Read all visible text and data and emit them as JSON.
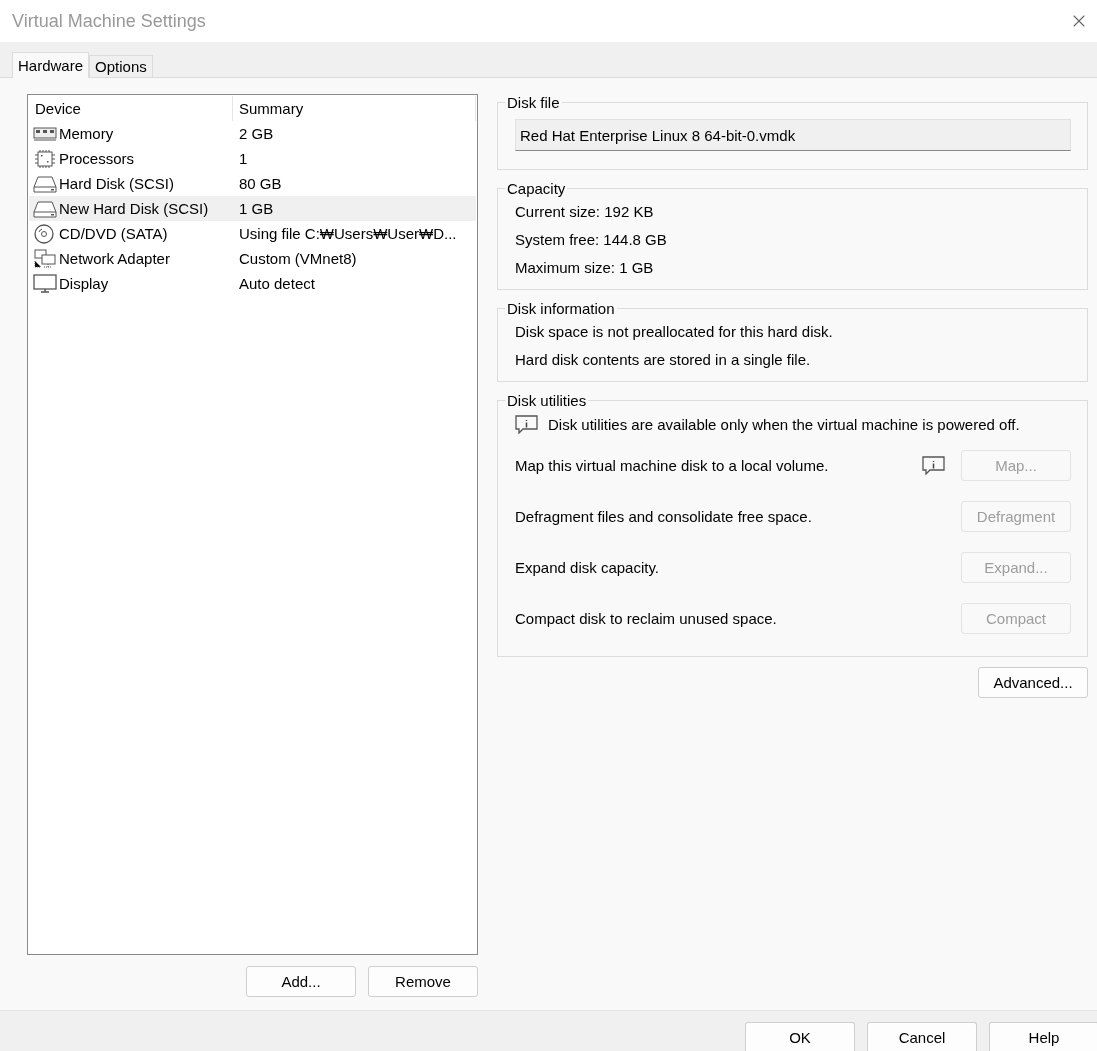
{
  "window": {
    "title": "Virtual Machine Settings"
  },
  "tabs": [
    {
      "label": "Hardware",
      "selected": true
    },
    {
      "label": "Options",
      "selected": false
    }
  ],
  "devices": {
    "columns": [
      "Device",
      "Summary"
    ],
    "rows": [
      {
        "kind": "memory",
        "device": "Memory",
        "summary": "2 GB",
        "selected": false
      },
      {
        "kind": "processor",
        "device": "Processors",
        "summary": "1",
        "selected": false
      },
      {
        "kind": "disk",
        "device": "Hard Disk (SCSI)",
        "summary": "80 GB",
        "selected": false
      },
      {
        "kind": "disk",
        "device": "New Hard Disk (SCSI)",
        "summary": "1 GB",
        "selected": true
      },
      {
        "kind": "cdrom",
        "device": "CD/DVD (SATA)",
        "summary": "Using file C:₩Users₩User₩D...",
        "selected": false
      },
      {
        "kind": "network",
        "device": "Network Adapter",
        "summary": "Custom (VMnet8)",
        "selected": false
      },
      {
        "kind": "display",
        "device": "Display",
        "summary": "Auto detect",
        "selected": false
      }
    ]
  },
  "list_buttons": [
    "Add...",
    "Remove"
  ],
  "disk_file": {
    "title": "Disk file",
    "value": "Red Hat Enterprise Linux 8 64-bit-0.vmdk"
  },
  "capacity": {
    "title": "Capacity",
    "lines": [
      "Current size: 192 KB",
      "System free: 144.8 GB",
      "Maximum size: 1 GB"
    ]
  },
  "disk_information": {
    "title": "Disk information",
    "lines": [
      "Disk space is not preallocated for this hard disk.",
      "Hard disk contents are stored in a single file."
    ]
  },
  "disk_utilities": {
    "title": "Disk utilities",
    "notice": "Disk utilities are available only when the virtual machine is powered off.",
    "rows": [
      {
        "label": "Map this virtual machine disk to a local volume.",
        "button": "Map...",
        "disabled": true,
        "info": true
      },
      {
        "label": "Defragment files and consolidate free space.",
        "button": "Defragment",
        "disabled": true,
        "info": false
      },
      {
        "label": "Expand disk capacity.",
        "button": "Expand...",
        "disabled": true,
        "info": false
      },
      {
        "label": "Compact disk to reclaim unused space.",
        "button": "Compact",
        "disabled": true,
        "info": false
      }
    ]
  },
  "advanced_button": "Advanced...",
  "footer_buttons": [
    "OK",
    "Cancel",
    "Help"
  ]
}
